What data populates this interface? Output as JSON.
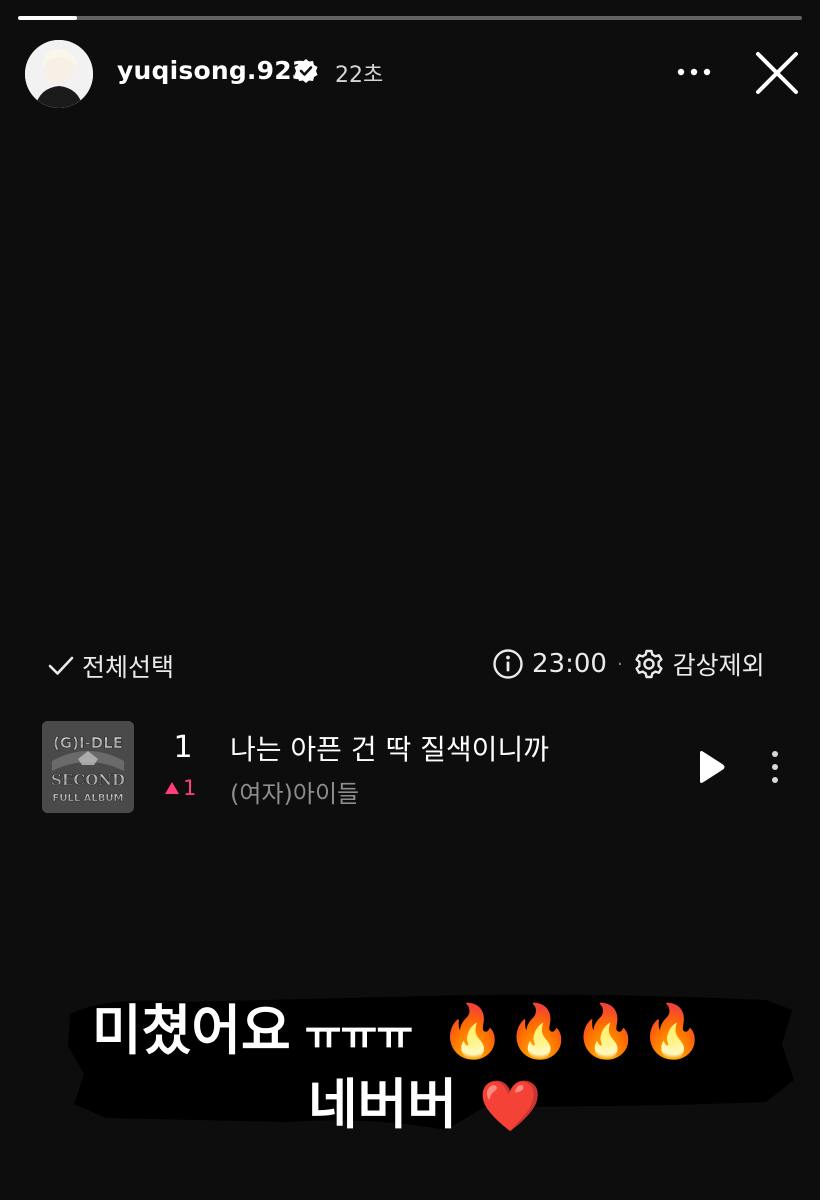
{
  "story": {
    "progress": 0.075
  },
  "header": {
    "username": "yuqisong.923",
    "time_ago": "22초",
    "icons": {
      "verified": "verified-badge-icon",
      "more": "more-horizontal-icon",
      "close": "close-icon"
    }
  },
  "playlist": {
    "select_all_label": "전체선택",
    "duration": "23:00",
    "exclude_label": "감상제외",
    "icons": {
      "check": "checkmark-icon",
      "info": "info-icon",
      "settings": "gear-icon"
    },
    "songs": [
      {
        "rank": "1",
        "rank_change": "1",
        "rank_direction": "up",
        "title": "나는 아픈 건 딱 질색이니까",
        "artist": "(여자)아이들",
        "album_art_text": [
          "(G)I-DLE",
          "SECOND",
          "FULL ALBUM"
        ]
      }
    ]
  },
  "caption": {
    "line1_text": "미쳤어요",
    "line1_tt": "ㅠㅠㅠ",
    "line1_emoji": "🔥🔥🔥🔥",
    "line2_text": "네버버",
    "line2_emoji": "❤️"
  },
  "colors": {
    "background": "#0d0d0d",
    "rank_up": "#ff3e7a",
    "artist_text": "#8d8d8d"
  }
}
